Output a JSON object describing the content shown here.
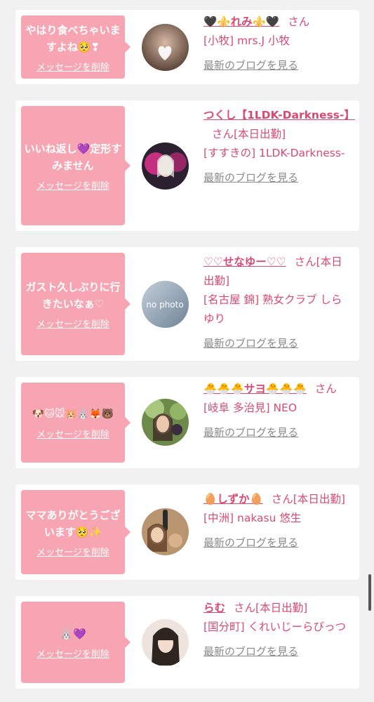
{
  "cards": [
    {
      "message": "やはり食べちゃいますよね🥺❣",
      "delete_label": "メッセージを削除",
      "name": "🖤⚜️れみ⚜️🖤",
      "suffix": "さん",
      "shop": "[小牧] mrs.J 小牧",
      "blog_label": "最新のブログを見る",
      "avatar_colors": [
        "#c9a892",
        "#5a4438"
      ]
    },
    {
      "message": "いいね返し💜定形すみません",
      "delete_label": "メッセージを削除",
      "name": "つくし【1LDK-Darkness-】",
      "suffix": "さん[本日出勤]",
      "shop": "[すすきの] 1LDK-Darkness-",
      "blog_label": "最新のブログを見る",
      "avatar_colors": [
        "#e0338d",
        "#2a2030"
      ]
    },
    {
      "message": "ガスト久しぶりに行きたいなぁ♡",
      "delete_label": "メッセージを削除",
      "name": "♡♡せなゆー♡♡",
      "suffix": "さん[本日出勤]",
      "shop": "[名古屋 錦] 熟女クラブ しらゆり",
      "blog_label": "最新のブログを見る",
      "avatar_colors": [
        "#aab8c8",
        "#6f8396"
      ],
      "avatar_text": "no photo"
    },
    {
      "message": "🐶🐱🐭🐹🐰🦊🐻",
      "delete_label": "メッセージを削除",
      "name": "🐣🐣🐣サヨ🐣🐣🐣",
      "suffix": "さん",
      "shop": "[岐阜 多治見] NEO",
      "blog_label": "最新のブログを見る",
      "avatar_colors": [
        "#8db06a",
        "#4f6a33"
      ]
    },
    {
      "message": "ママありがとうございます🥺✨",
      "delete_label": "メッセージを削除",
      "name": "🥚しずか🥚",
      "suffix": "さん[本日出勤]",
      "shop": "[中洲] nakasu 悠生",
      "blog_label": "最新のブログを見る",
      "avatar_colors": [
        "#c7a27a",
        "#6d4b2e"
      ]
    },
    {
      "message": "🐰💜",
      "delete_label": "メッセージを削除",
      "name": "らむ",
      "suffix": "さん[本日出勤]",
      "shop": "[国分町] くれいじーらびっつ",
      "blog_label": "最新のブログを見る",
      "avatar_colors": [
        "#efe4dd",
        "#3b2f2b"
      ]
    }
  ]
}
